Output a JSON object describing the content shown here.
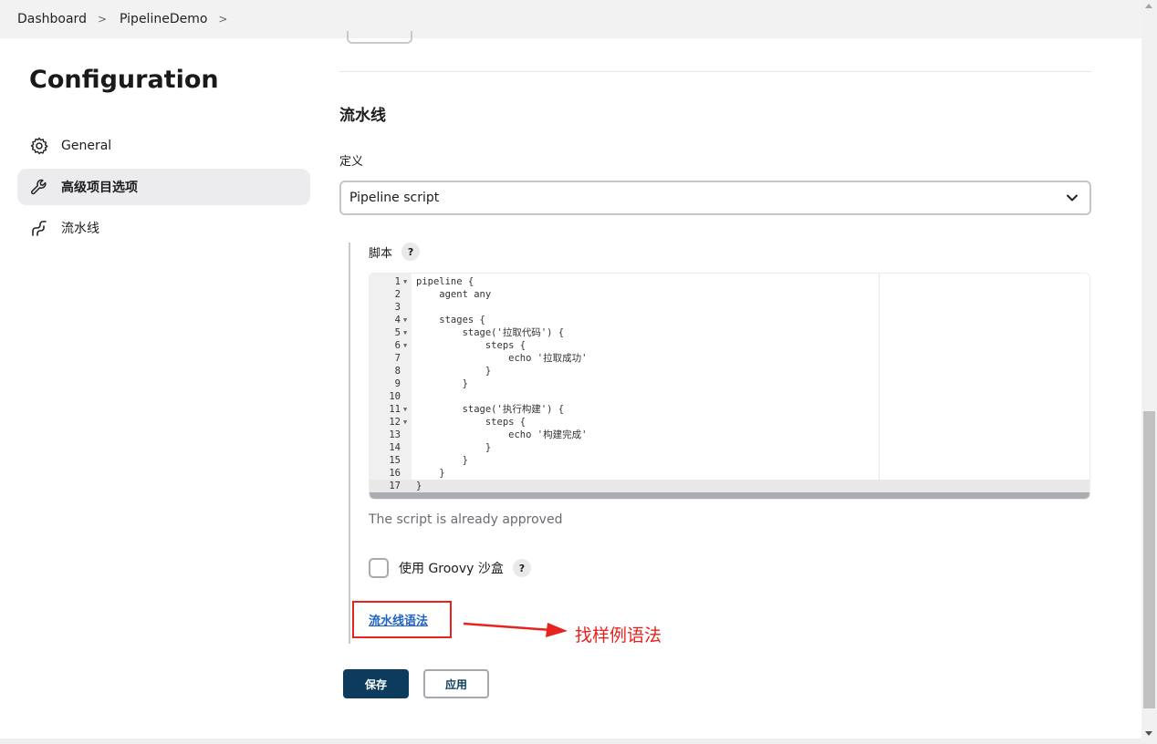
{
  "breadcrumb": {
    "items": [
      "Dashboard",
      "PipelineDemo"
    ],
    "separator": ">"
  },
  "sidebar": {
    "title": "Configuration",
    "items": [
      {
        "label": "General",
        "icon": "gear-icon",
        "active": false
      },
      {
        "label": "高级项目选项",
        "icon": "wrench-icon",
        "active": true
      },
      {
        "label": "流水线",
        "icon": "pipeline-icon",
        "active": false
      }
    ]
  },
  "main": {
    "section_title": "流水线",
    "definition_label": "定义",
    "definition_value": "Pipeline script",
    "script_label": "脚本",
    "help_glyph": "?",
    "script_lines": [
      {
        "n": "1",
        "code": "pipeline {",
        "fold": true
      },
      {
        "n": "2",
        "code": "    agent any",
        "fold": false
      },
      {
        "n": "3",
        "code": "",
        "fold": false
      },
      {
        "n": "4",
        "code": "    stages {",
        "fold": true
      },
      {
        "n": "5",
        "code": "        stage('拉取代码') {",
        "fold": true
      },
      {
        "n": "6",
        "code": "            steps {",
        "fold": true
      },
      {
        "n": "7",
        "code": "                echo '拉取成功'",
        "fold": false
      },
      {
        "n": "8",
        "code": "            }",
        "fold": false
      },
      {
        "n": "9",
        "code": "        }",
        "fold": false
      },
      {
        "n": "10",
        "code": "",
        "fold": false
      },
      {
        "n": "11",
        "code": "        stage('执行构建') {",
        "fold": true
      },
      {
        "n": "12",
        "code": "            steps {",
        "fold": true
      },
      {
        "n": "13",
        "code": "                echo '构建完成'",
        "fold": false
      },
      {
        "n": "14",
        "code": "            }",
        "fold": false
      },
      {
        "n": "15",
        "code": "        }",
        "fold": false
      },
      {
        "n": "16",
        "code": "    }",
        "fold": false
      },
      {
        "n": "17",
        "code": "}",
        "fold": false
      }
    ],
    "approved_text": "The script is already approved",
    "groovy_sandbox_label": "使用 Groovy 沙盒",
    "groovy_sandbox_checked": false,
    "syntax_link": "流水线语法",
    "annotation": "找样例语法",
    "save_label": "保存",
    "apply_label": "应用"
  },
  "colors": {
    "accent": "#0d3b5e",
    "link": "#1f63c3",
    "annotation_red": "#e8231f"
  }
}
